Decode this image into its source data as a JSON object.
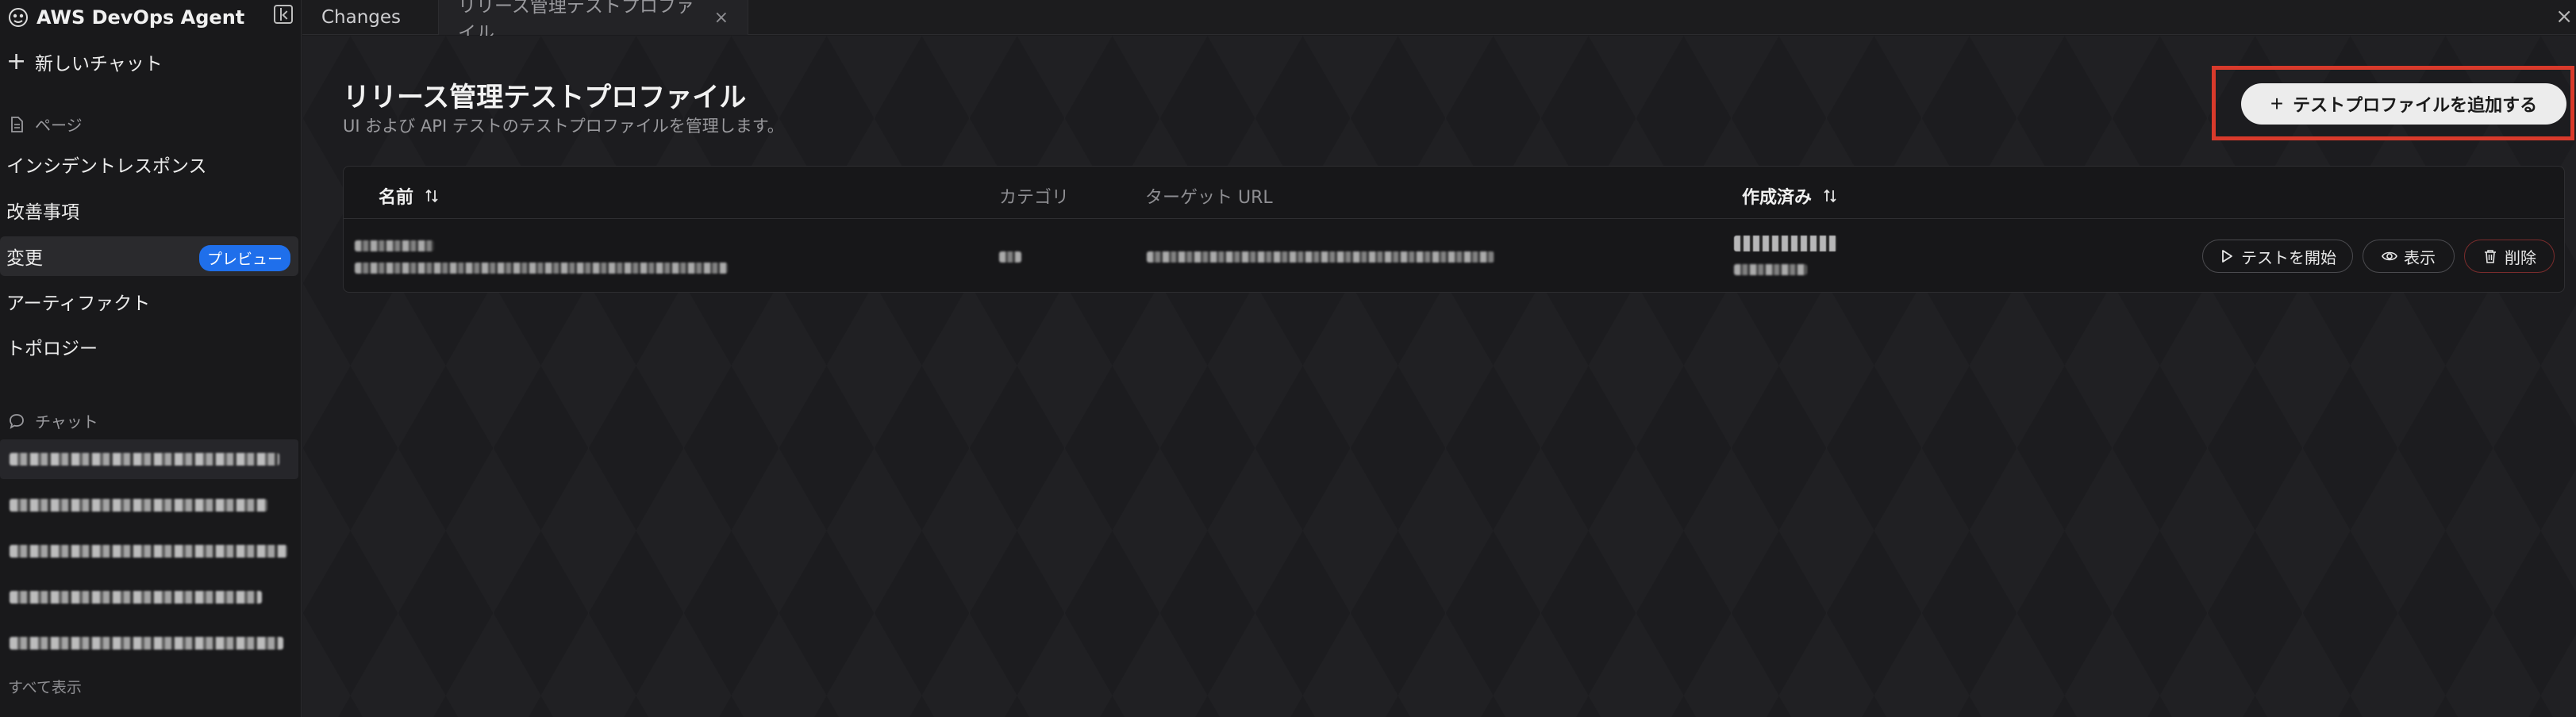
{
  "sidebar": {
    "brand_title": "AWS DevOps Agent",
    "new_chat_label": "新しいチャット",
    "pages_section_label": "ページ",
    "nav_items": [
      {
        "label": "インシデントレスポンス"
      },
      {
        "label": "改善事項"
      },
      {
        "label": "変更",
        "badge": "プレビュー"
      },
      {
        "label": "アーティファクト"
      },
      {
        "label": "トポロジー"
      }
    ],
    "chat_section_label": "チャット",
    "show_all_label": "すべて表示"
  },
  "tabs": [
    {
      "label": "Changes"
    },
    {
      "label": "リリース管理テストプロファイル",
      "close": "×"
    }
  ],
  "window_close": "×",
  "main": {
    "title": "リリース管理テストプロファイル",
    "subtitle": "UI および API テストのテストプロファイルを管理します。",
    "add_button_label": "テストプロファイルを追加する",
    "table": {
      "headers": {
        "name": "名前",
        "category": "カテゴリ",
        "target_url": "ターゲット URL",
        "created": "作成済み"
      },
      "row_actions": {
        "start": "テストを開始",
        "view": "表示",
        "delete": "削除"
      }
    }
  },
  "colors": {
    "accent_badge": "#1f6feb",
    "highlight_border": "#d93a2b",
    "background": "#1b1b1d"
  }
}
